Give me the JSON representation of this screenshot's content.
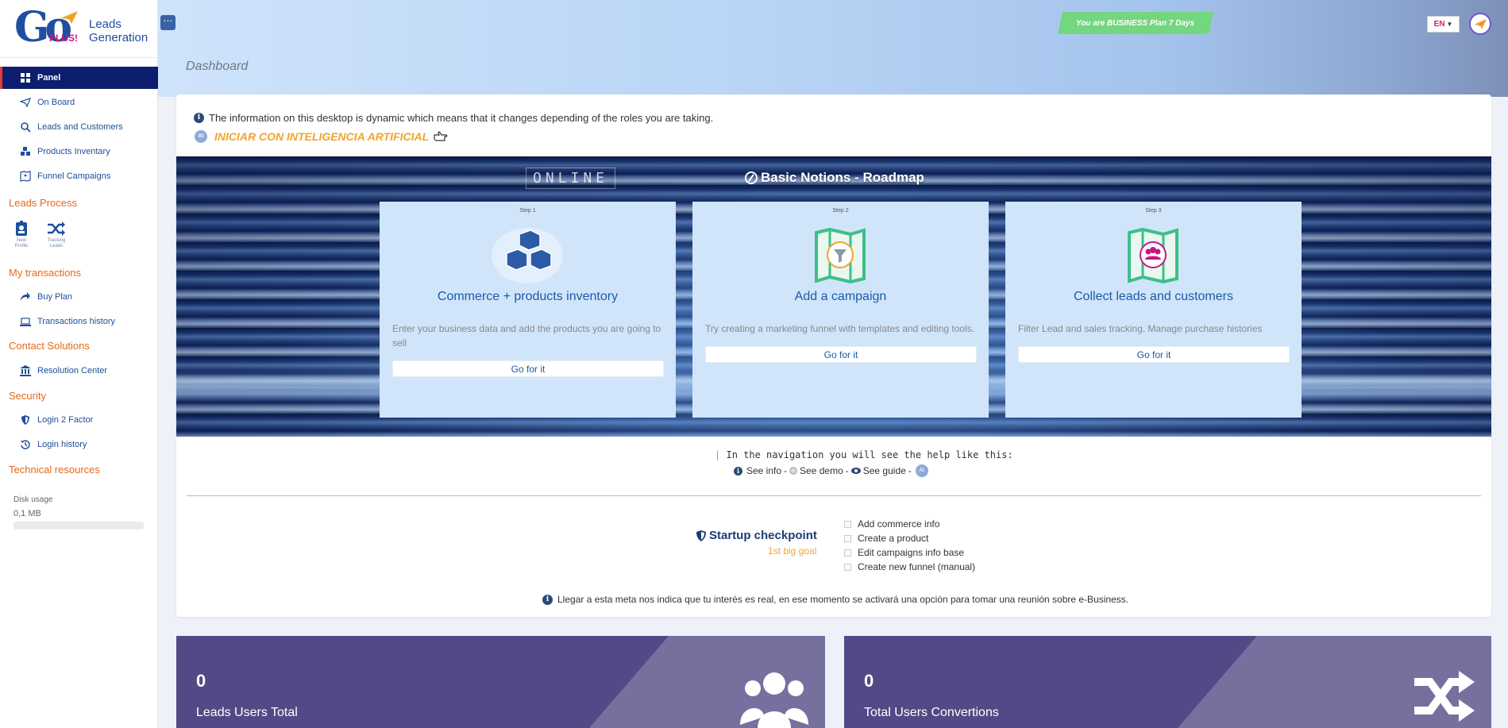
{
  "sidebar": {
    "logo": {
      "go": "Go",
      "plus": "PLUS!",
      "line1": "Leads",
      "line2": "Generation"
    },
    "items": [
      {
        "label": "Panel",
        "icon": "grid-icon"
      },
      {
        "label": "On Board",
        "icon": "paper-plane-icon"
      },
      {
        "label": "Leads and Customers",
        "icon": "search-icon"
      },
      {
        "label": "Products Inventary",
        "icon": "cubes-icon"
      },
      {
        "label": "Funnel Campaigns",
        "icon": "funnel-map-icon"
      }
    ],
    "sections": {
      "leads_process": "Leads Process",
      "my_transactions": "My transactions",
      "contact_solutions": "Contact Solutions",
      "security": "Security",
      "technical_resources": "Technical resources"
    },
    "process_icons": [
      {
        "label1": "New",
        "label2": "Profile",
        "icon": "id-badge-icon"
      },
      {
        "label1": "Tracking",
        "label2": "Leads",
        "icon": "shuffle-icon"
      }
    ],
    "transactions": [
      {
        "label": "Buy Plan",
        "icon": "share-arrow-icon"
      },
      {
        "label": "Transactions history",
        "icon": "laptop-icon"
      }
    ],
    "contact": [
      {
        "label": "Resolution Center",
        "icon": "bank-icon"
      }
    ],
    "security_items": [
      {
        "label": "Login 2 Factor",
        "icon": "shield-icon"
      },
      {
        "label": "Login history",
        "icon": "history-icon"
      }
    ],
    "disk": {
      "label": "Disk usage",
      "value": "0,1 MB",
      "fraction": 0.0
    }
  },
  "header": {
    "menu_button": "⋯",
    "plan_badge": "You are BUSINESS Plan 7 Days",
    "language": "EN",
    "page_title": "Dashboard"
  },
  "main": {
    "info_text": "The information on this desktop is dynamic which means that it changes depending of the roles you are taking.",
    "ai_badge": "AI",
    "ai_text": "INICIAR CON INTELIGENCIA ARTIFICIAL",
    "banner": {
      "online_text": "ONLINE",
      "title": "Basic Notions - Roadmap",
      "steps": [
        {
          "num": "Step 1",
          "title": "Commerce + products inventory",
          "desc": "Enter your business data and add the products you are going to sell",
          "button": "Go for it",
          "icon": "cubes-icon"
        },
        {
          "num": "Step 2",
          "title": "Add a campaign",
          "desc": "Try creating a marketing funnel with templates and editing tools.",
          "button": "Go for it",
          "icon": "funnel-map-icon"
        },
        {
          "num": "Step 3",
          "title": "Collect leads and customers",
          "desc": "Filter Lead and sales tracking. Manage purchase histories",
          "button": "Go for it",
          "icon": "users-map-icon"
        }
      ]
    },
    "help": {
      "line1": "In the navigation you will see the help like this:",
      "see_info": "See info",
      "see_demo": "See demo",
      "see_guide": "See guide",
      "sep": "-"
    },
    "checkpoint": {
      "title": "Startup checkpoint",
      "subtitle": "1st big goal",
      "items": [
        "Add commerce info",
        "Create a product",
        "Edit campaigns info base",
        "Create new funnel (manual)"
      ],
      "note": "Llegar a esta meta nos indica que tu interés es real, en ese momento se activará una opción para tomar una reunión sobre e-Business."
    }
  },
  "stats": [
    {
      "value": "0",
      "label": "Leads Users Total",
      "icon": "users-icon"
    },
    {
      "value": "0",
      "label": "Total Users Convertions",
      "icon": "shuffle-icon"
    }
  ],
  "colors": {
    "sidebar_active": "#0d1e6e",
    "section_title": "#e46a1b",
    "accent_blue": "#1e4fa0",
    "plan_green": "#74d67e",
    "stat_purple": "#524a86",
    "ai_orange": "#f0a52a"
  }
}
